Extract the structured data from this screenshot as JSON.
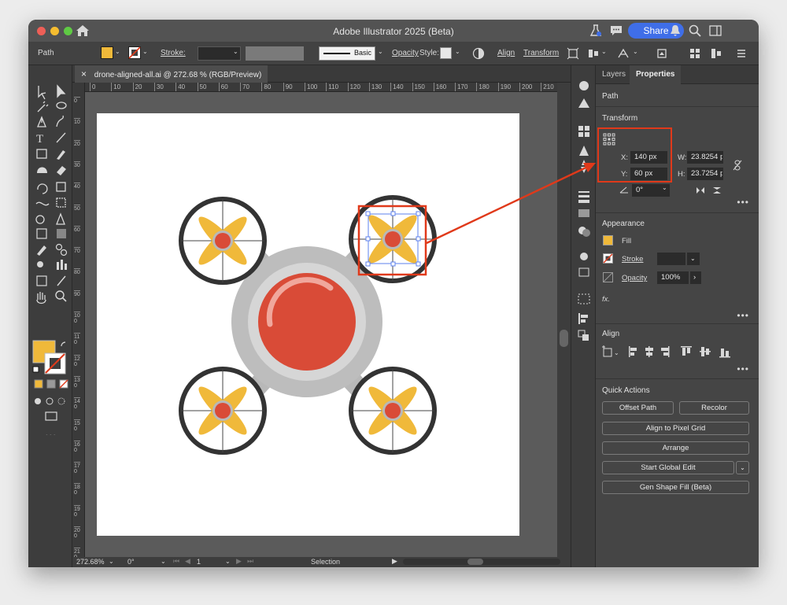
{
  "titlebar": {
    "title": "Adobe Illustrator 2025 (Beta)",
    "share_label": "Share"
  },
  "controlbar": {
    "object_type": "Path",
    "stroke_label": "Stroke:",
    "brush_label": "Basic",
    "opacity_label": "Opacity",
    "style_label": "Style:",
    "align_label": "Align",
    "transform_label": "Transform"
  },
  "document": {
    "tab_title": "drone-aligned-all.ai @ 272.68 % (RGB/Preview)",
    "close_glyph": "×"
  },
  "ruler": {
    "top_ticks": [
      "0",
      "10",
      "20",
      "30",
      "40",
      "50",
      "60",
      "70",
      "80",
      "90",
      "100",
      "110",
      "120",
      "130",
      "140",
      "150",
      "160",
      "170",
      "180",
      "190",
      "200",
      "210"
    ],
    "left_ticks": [
      "0",
      "1 0",
      "2 0",
      "3 0",
      "4 0",
      "5 0",
      "6 0",
      "7 0",
      "8 0",
      "9 0",
      "1 0 0",
      "1 1 0",
      "1 2 0",
      "1 3 0",
      "1 4 0",
      "1 5 0",
      "1 6 0",
      "1 7 0",
      "1 8 0",
      "1 9 0",
      "2 0 0",
      "2 1 0"
    ]
  },
  "statusbar": {
    "zoom": "272.68%",
    "rotation": "0°",
    "artboard": "1",
    "tool": "Selection"
  },
  "panel": {
    "tabs": [
      "Layers",
      "Properties"
    ],
    "object_type": "Path",
    "transform": {
      "title": "Transform",
      "x_label": "X:",
      "x_value": "140 px",
      "y_label": "Y:",
      "y_value": "60 px",
      "w_label": "W:",
      "w_value": "23.8254 p",
      "h_label": "H:",
      "h_value": "23.7254 p",
      "angle_value": "0°"
    },
    "appearance": {
      "title": "Appearance",
      "fill_label": "Fill",
      "stroke_label": "Stroke",
      "opacity_label": "Opacity",
      "opacity_value": "100%",
      "fx_label": "fx."
    },
    "align": {
      "title": "Align"
    },
    "quick_actions": {
      "title": "Quick Actions",
      "offset_path": "Offset Path",
      "recolor": "Recolor",
      "align_pixel": "Align to Pixel Grid",
      "arrange": "Arrange",
      "global_edit": "Start Global Edit",
      "gen_shape": "Gen Shape Fill (Beta)"
    },
    "more_glyph": "•••"
  },
  "colors": {
    "fill_swatch": "#f0b93a",
    "highlight": "#e0391a",
    "share_blue": "#3f6ee8",
    "propeller": "#f0b93a",
    "hub_red": "#d94b37",
    "ring_dark": "#333333",
    "body_gray": "#b8b8b8"
  }
}
